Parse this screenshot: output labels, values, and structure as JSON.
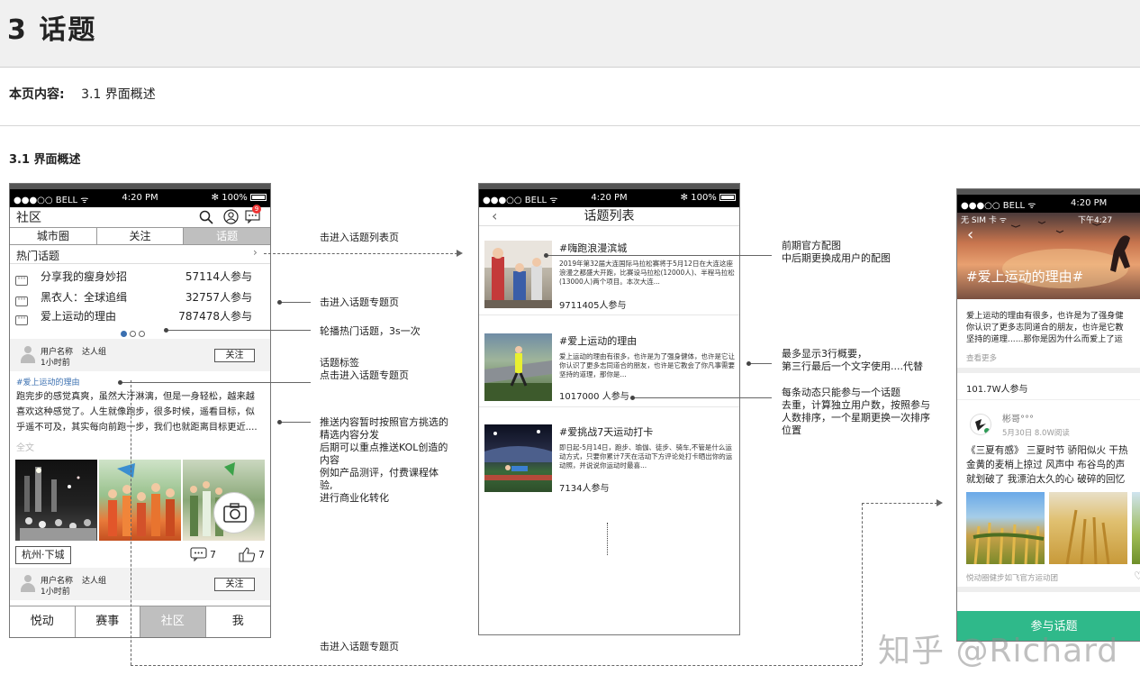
{
  "page": {
    "title": "3  话题",
    "toc_label": "本页内容:",
    "toc_item": "3.1  界面概述",
    "section_title": "3.1  界面概述"
  },
  "status_bar": {
    "carrier": "●●●○○ BELL ᯤ",
    "time": "4:20 PM",
    "battery": "✻ 100%"
  },
  "phone1": {
    "title": "社区",
    "badge": "9",
    "tabs": [
      "城市圈",
      "关注",
      "话题"
    ],
    "hot_header": "热门话题",
    "hot_topics": [
      {
        "name": "分享我的瘦身妙招",
        "count": "57114人参与"
      },
      {
        "name": "黑衣人：全球追缉",
        "count": "32757人参与"
      },
      {
        "name": "爱上运动的理由",
        "count": "787478人参与"
      }
    ],
    "user_name": "用户名称",
    "user_group": "达人组",
    "user_time": "1小时前",
    "follow": "关注",
    "topic_tag": "#爱上运动的理由",
    "post_line1": "跑完步的感觉真爽，虽然大汗淋漓，但是一身轻松，越来越",
    "post_line2": "喜欢这种感觉了。人生就像跑步，很多时候，遥看目标，似",
    "post_line3": "乎遥不可及，其实每向前跑一步，我们也就距离目标更近....",
    "full_text": "全文",
    "location": "杭州·下城",
    "comments": "7",
    "likes": "7",
    "user2_name": "用户名称",
    "user2_group": "达人组",
    "user2_time": "1小时前",
    "bottom_tabs": [
      "悦动",
      "赛事",
      "社区",
      "我"
    ]
  },
  "phone2": {
    "title": "话题列表",
    "items": [
      {
        "title": "#嗨跑浪漫滨城",
        "desc": "2019年第32届大连国际马拉松赛将于5月12日在大连这座浪漫之都盛大开跑，比赛设马拉松(12000人)、半程马拉松(13000人)两个项目。本次大连...",
        "count": "9711405人参与"
      },
      {
        "title": "#爱上运动的理由",
        "desc": "爱上运动的理由有很多，也许是为了强身健体，也许是它让你认识了更多志同道合的朋友，也许是它教会了你凡事需要坚持的道理，那你是...",
        "count": "1017000 人参与"
      },
      {
        "title": "#爱挑战7天运动打卡",
        "desc": "即日起-5月14日，跑步、瑜伽、徒步、骑车,不管是什么运动方式，只要你累计7天在活动下方评论处打卡晒出你的运动照，并说说你运动时最喜...",
        "count": "7134人参与"
      }
    ]
  },
  "phone3": {
    "inner_status": "无 SIM 卡 ᯤ",
    "inner_time": "下午4:27",
    "banner_title": "#爱上运动的理由#",
    "desc_line1": "爱上运动的理由有很多，也许是为了强身健",
    "desc_line2": "你认识了更多志同道合的朋友，也许是它教",
    "desc_line3": "坚持的道理......那你是因为什么而爱上了运",
    "see_more": "查看更多",
    "participants": "101.7W人参与",
    "poster_name": "彬哥°°°",
    "poster_meta": "5月30日  8.0W阅读",
    "post_line1": "《三夏有感》 三夏时节 骄阳似火 干热",
    "post_line2": "金黄的麦梢上掠过 风声中 布谷鸟的声",
    "post_line3": "就划破了 我漂泊太久的心 破碎的回忆",
    "source": "悦动圈健步如飞官方运动团",
    "join": "参与话题"
  },
  "annotations": {
    "a1": "击进入话题列表页",
    "a2": "击进入话题专题页",
    "a3": "轮播热门话题，3s一次",
    "a4_line1": "话题标签",
    "a4_line2": "点击进入话题专题页",
    "a5_lines": [
      "推送内容暂时按照官方挑选的",
      "精选内容分发",
      "后期可以重点推送KOL创造的",
      "内容",
      "例如产品测评，付费课程体",
      "验,",
      "进行商业化转化"
    ],
    "a6": "击进入话题专题页",
    "b1_line1": "前期官方配图",
    "b1_line2": "中后期更换成用户的配图",
    "b2_line1": "最多显示3行概要，",
    "b2_line2": "第三行最后一个文字使用....代替",
    "b3_lines": [
      "每条动态只能参与一个话题",
      "去重，计算独立用户数，按照参与",
      "人数排序，一个星期更换一次排序",
      "位置"
    ]
  },
  "watermark": "知乎 @Richard"
}
